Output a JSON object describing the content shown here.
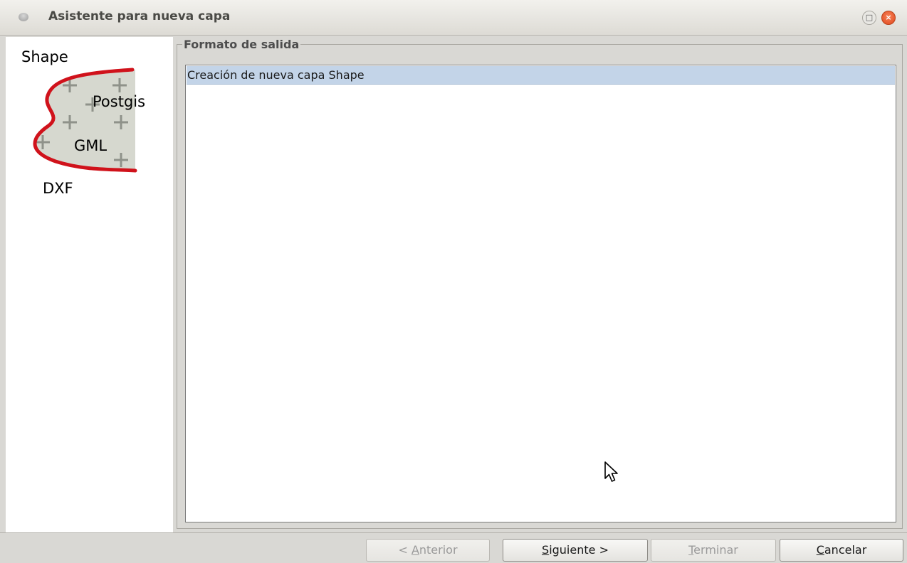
{
  "window": {
    "title": "Asistente para nueva capa"
  },
  "logo": {
    "labels": [
      "Shape",
      "Postgis",
      "GML",
      "DXF"
    ]
  },
  "output_format": {
    "legend": "Formato de salida",
    "items": [
      {
        "label": "Creación de nueva capa Shape",
        "selected": true
      }
    ]
  },
  "buttons": {
    "previous": {
      "prefix": "< ",
      "mnemonic": "A",
      "rest": "nterior",
      "enabled": false
    },
    "next": {
      "mnemonic": "S",
      "rest": "iguiente >",
      "enabled": true
    },
    "finish": {
      "mnemonic": "T",
      "rest": "erminar",
      "enabled": false
    },
    "cancel": {
      "mnemonic": "C",
      "rest": "ancelar",
      "enabled": true
    }
  },
  "colors": {
    "selection": "#c3d4e8",
    "logo_curve": "#d0121b",
    "logo_fill": "#d6d8cf",
    "close_button": "#e5511f"
  }
}
